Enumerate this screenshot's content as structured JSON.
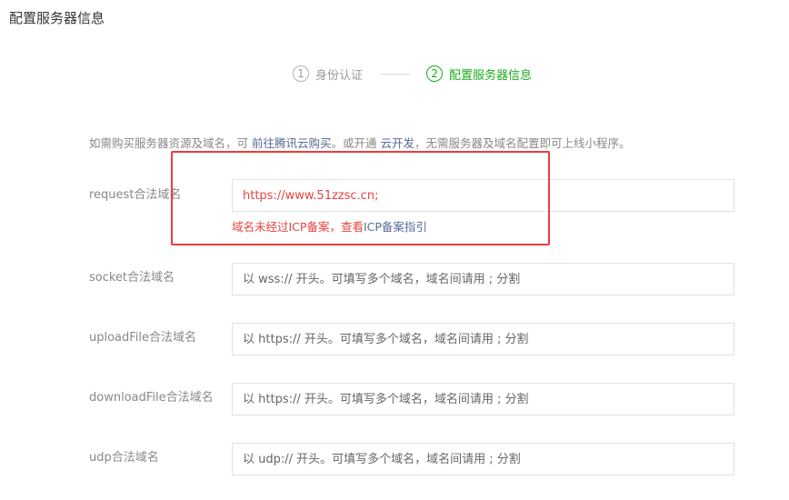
{
  "page": {
    "title": "配置服务器信息"
  },
  "steps": [
    {
      "num": "1",
      "label": "身份认证",
      "state": "inactive"
    },
    {
      "num": "2",
      "label": "配置服务器信息",
      "state": "active"
    }
  ],
  "intro": {
    "prefix": "如需购买服务器资源及域名，可",
    "link1": "前往腾讯云购买",
    "middle": "。或开通",
    "link2": "云开发",
    "suffix": "，无需服务器及域名配置即可上线小程序。"
  },
  "fields": {
    "request": {
      "label": "request合法域名",
      "value": "https://www.51zzsc.cn;"
    },
    "socket": {
      "label": "socket合法域名",
      "placeholder": "以 wss:// 开头。可填写多个域名，域名间请用 ; 分割"
    },
    "uploadFile": {
      "label": "uploadFile合法域名",
      "placeholder": "以 https:// 开头。可填写多个域名，域名间请用 ; 分割"
    },
    "downloadFile": {
      "label": "downloadFile合法域名",
      "placeholder": "以 https:// 开头。可填写多个域名，域名间请用 ; 分割"
    },
    "udp": {
      "label": "udp合法域名",
      "placeholder": "以 udp:// 开头。可填写多个域名，域名间请用 ; 分割"
    }
  },
  "error": {
    "text": "域名未经过ICP备案，查看",
    "link": "ICP备案指引"
  },
  "colors": {
    "active": "#1aad19",
    "error": "#e64340",
    "link": "#576b95",
    "highlight": "#e8403c"
  }
}
